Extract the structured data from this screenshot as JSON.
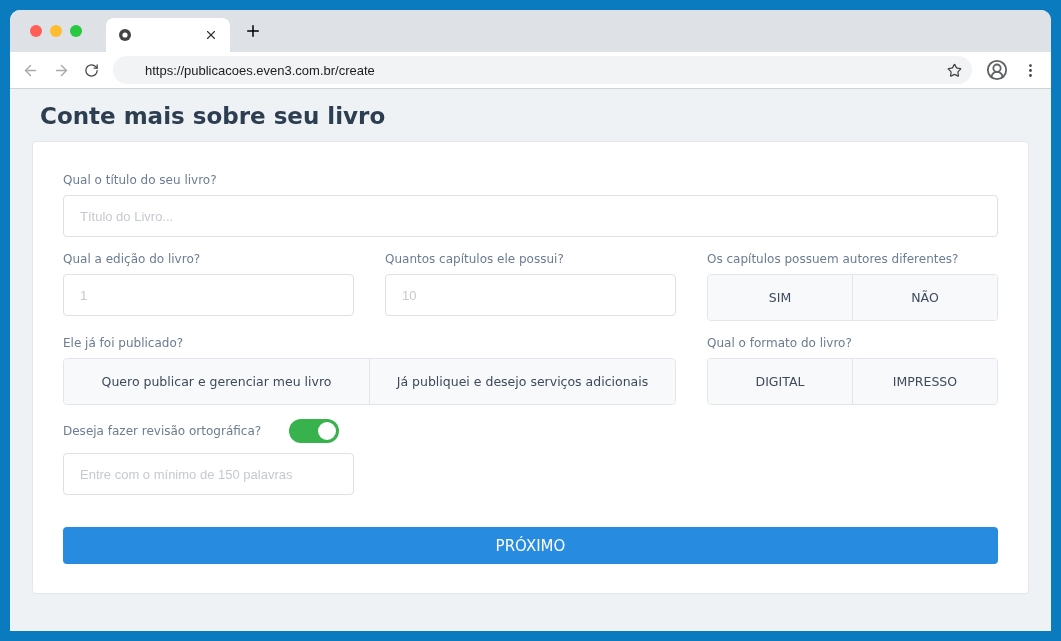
{
  "browser": {
    "url": "https://publicacoes.even3.com.br/create"
  },
  "page": {
    "title": "Conte mais sobre seu livro"
  },
  "form": {
    "title_field": {
      "label": "Qual o título do seu livro?",
      "placeholder": "Título do Livro..."
    },
    "edition_field": {
      "label": "Qual a edição do livro?",
      "placeholder": "1"
    },
    "chapters_field": {
      "label": "Quantos capítulos ele possui?",
      "placeholder": "10"
    },
    "different_authors": {
      "label": "Os capítulos possuem autores diferentes?",
      "options": [
        {
          "label": "SIM",
          "selected": false
        },
        {
          "label": "NÃO",
          "selected": false
        }
      ]
    },
    "published": {
      "label": "Ele já foi publicado?",
      "options": [
        {
          "label": "Quero publicar e gerenciar meu livro",
          "selected": false
        },
        {
          "label": "Já publiquei e desejo serviços adicionais",
          "selected": false
        }
      ]
    },
    "format": {
      "label": "Qual o formato do livro?",
      "options": [
        {
          "label": "DIGITAL",
          "selected": false
        },
        {
          "label": "IMPRESSO",
          "selected": false
        }
      ]
    },
    "proofreading": {
      "label": "Deseja fazer revisão ortográfica?",
      "on": true,
      "placeholder": "Entre com o mínimo de 150 palavras"
    },
    "next_button": "PRÓXIMO"
  }
}
